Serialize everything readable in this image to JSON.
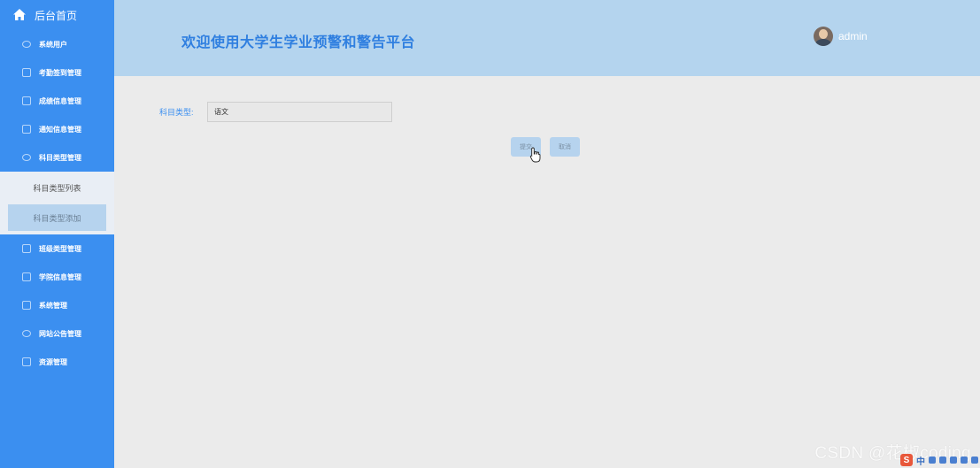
{
  "sidebar": {
    "home_label": "后台首页",
    "items": [
      {
        "label": "系统用户",
        "icon": "chat-icon"
      },
      {
        "label": "考勤签到管理",
        "icon": "edit-icon"
      },
      {
        "label": "成绩信息管理",
        "icon": "list-icon"
      },
      {
        "label": "通知信息管理",
        "icon": "edit-icon"
      },
      {
        "label": "科目类型管理",
        "icon": "chat-icon"
      }
    ],
    "submenu": [
      {
        "label": "科目类型列表"
      },
      {
        "label": "科目类型添加"
      }
    ],
    "items_after": [
      {
        "label": "班级类型管理",
        "icon": "check-icon"
      },
      {
        "label": "学院信息管理",
        "icon": "box-icon"
      },
      {
        "label": "系统管理",
        "icon": "edit-icon"
      },
      {
        "label": "网站公告管理",
        "icon": "chat-icon"
      },
      {
        "label": "资源管理",
        "icon": "edit-icon"
      }
    ]
  },
  "header": {
    "title": "欢迎使用大学生学业预警和警告平台",
    "username": "admin"
  },
  "form": {
    "label": "科目类型:",
    "value": "语文"
  },
  "buttons": {
    "submit": "提交",
    "cancel": "取消"
  },
  "watermark": "CSDN @花椒coding",
  "ime": {
    "char": "中"
  },
  "colors": {
    "sidebar": "#3b8ff0",
    "header": "#b4d4ee",
    "title": "#2f7fe0",
    "button": "#b6d3ee"
  }
}
